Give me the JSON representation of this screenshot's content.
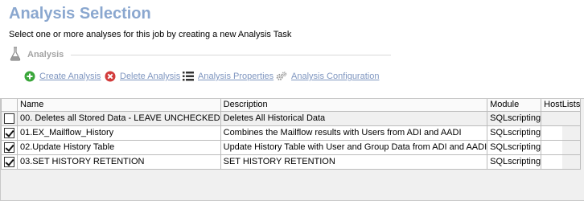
{
  "header": {
    "title": "Analysis Selection",
    "subtitle": "Select one or more analyses for this job by creating a new Analysis Task"
  },
  "section": {
    "label": "Analysis",
    "icon": "flask-icon"
  },
  "toolbar": {
    "create_label": "Create Analysis",
    "delete_label": "Delete Analysis",
    "properties_label": "Analysis Properties",
    "configuration_label": "Analysis Configuration"
  },
  "grid": {
    "columns": {
      "name": "Name",
      "description": "Description",
      "module": "Module",
      "hostlists": "HostLists"
    },
    "rows": [
      {
        "checked": false,
        "name": "00. Deletes all Stored Data - LEAVE UNCHECKED",
        "description": "Deletes All Historical Data",
        "module": "SQLscripting",
        "hostlists": ""
      },
      {
        "checked": true,
        "name": "01.EX_Mailflow_History",
        "description": "Combines the Mailflow results with Users from ADI and AADI",
        "module": "SQLscripting",
        "hostlists": ""
      },
      {
        "checked": true,
        "name": "02.Update History Table",
        "description": "Update History Table with User and Group Data from ADI and AADI",
        "module": "SQLscripting",
        "hostlists": ""
      },
      {
        "checked": true,
        "name": "03.SET HISTORY RETENTION",
        "description": "SET HISTORY RETENTION",
        "module": "SQLscripting",
        "hostlists": ""
      }
    ]
  },
  "colors": {
    "title": "#8aa7cf",
    "link": "#7f96c0",
    "create_icon": "#3aa63a",
    "delete_icon": "#d23b3b"
  }
}
